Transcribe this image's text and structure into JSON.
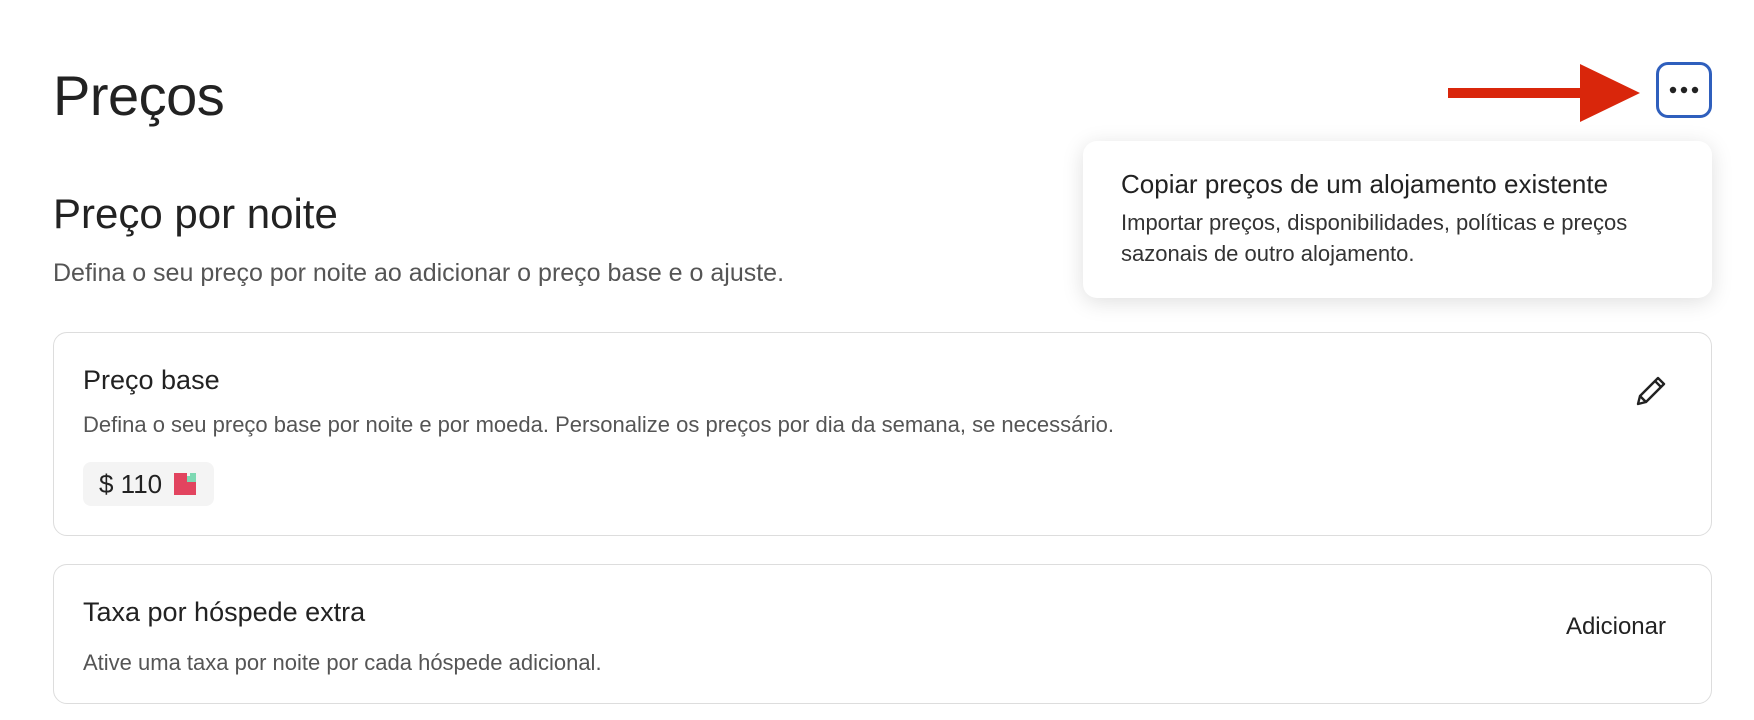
{
  "page": {
    "title": "Preços"
  },
  "header": {
    "more_icon": "more-horizontal-icon"
  },
  "menu": {
    "items": [
      {
        "title": "Copiar preços de um alojamento existente",
        "description": "Importar preços, disponibilidades, políticas e preços sazonais de outro alojamento."
      }
    ]
  },
  "nightly_section": {
    "title": "Preço por noite",
    "subtitle": "Defina o seu preço por noite ao adicionar o preço base e o ajuste."
  },
  "base_price_card": {
    "title": "Preço base",
    "description": "Defina o seu preço base por noite e por moeda. Personalize os preços por dia da semana, se necessário.",
    "price": "$ 110",
    "edit_icon": "pencil-icon",
    "logo_colors": {
      "primary": "#e2445f",
      "accent": "#7ed9b3"
    }
  },
  "extra_guest_card": {
    "title": "Taxa por hóspede extra",
    "description": "Ative uma taxa por noite por cada hóspede adicional.",
    "action_label": "Adicionar"
  },
  "colors": {
    "annotation_arrow": "#d9260b",
    "focus_ring": "#2f5fbd"
  }
}
